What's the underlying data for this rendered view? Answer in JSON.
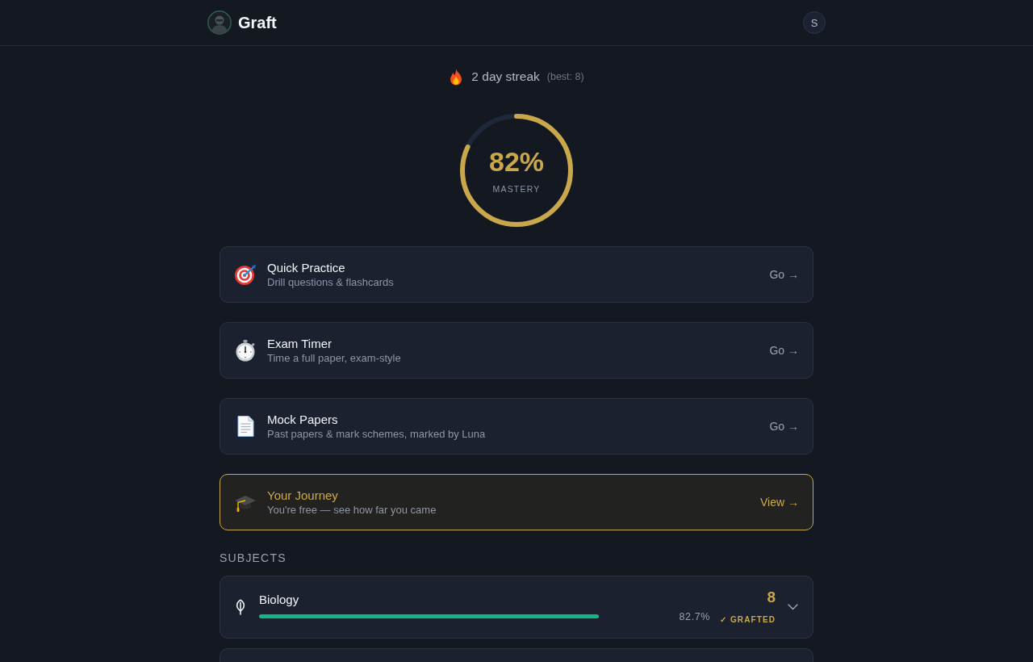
{
  "header": {
    "brand": "Graft",
    "user_initial": "S"
  },
  "streak": {
    "text": "2 day streak",
    "best": "(best: 8)"
  },
  "mastery": {
    "value": "82%",
    "label": "MASTERY",
    "level": 0.82
  },
  "actions": [
    {
      "kind": "practice",
      "title": "Quick Practice",
      "subtitle": "Drill questions & flashcards",
      "action": "Go →",
      "highlighted": false
    },
    {
      "kind": "timer",
      "title": "Exam Timer",
      "subtitle": "Time a full paper, exam-style",
      "action": "Go →",
      "highlighted": false
    },
    {
      "kind": "papers",
      "title": "Mock Papers",
      "subtitle": "Past papers & mark schemes, marked by Luna",
      "action": "Go →",
      "highlighted": false
    },
    {
      "kind": "journey",
      "title": "Your Journey",
      "subtitle": "You're free — see how far you came",
      "action": "View →",
      "highlighted": true
    }
  ],
  "subjects_heading": "SUBJECTS",
  "subjects": [
    {
      "name": "Biology",
      "level": 0.827,
      "reading": "82.7%",
      "grade": "8",
      "badge": "✓ GRAFTED",
      "expanded": false
    }
  ]
}
